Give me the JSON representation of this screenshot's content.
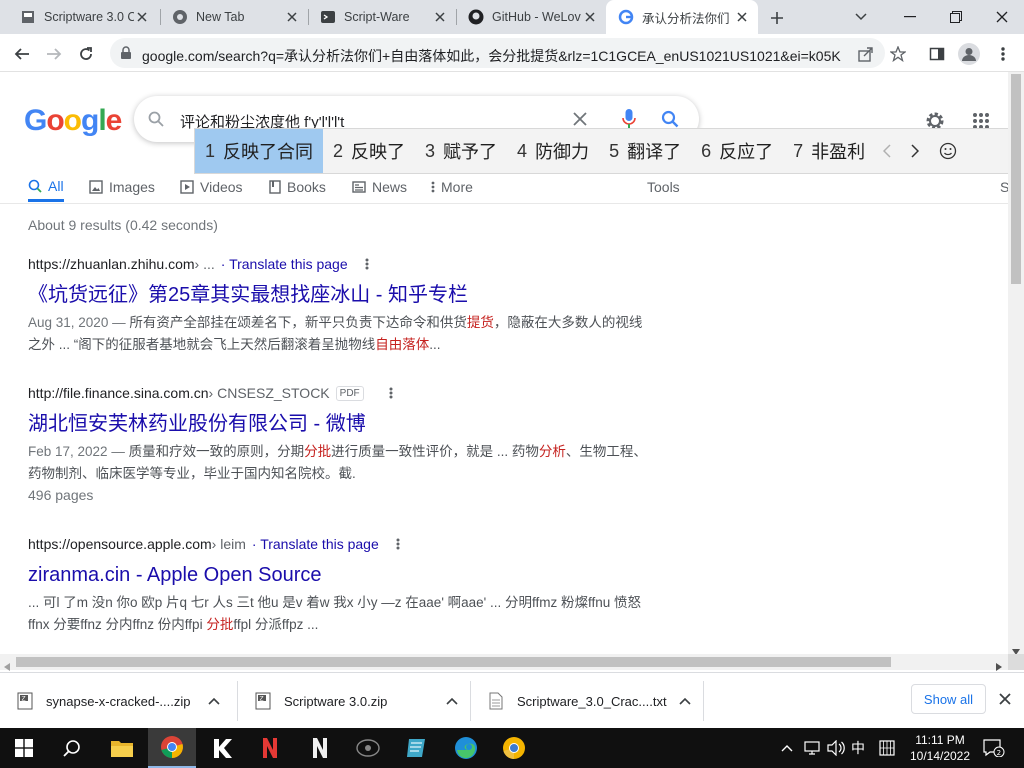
{
  "browser": {
    "tabs": [
      {
        "title": "Scriptware 3.0 C",
        "icon": "page-icon"
      },
      {
        "title": "New Tab",
        "icon": "chrome-icon"
      },
      {
        "title": "Script-Ware",
        "icon": "script-ware-icon"
      },
      {
        "title": "GitHub - WeLov",
        "icon": "github-icon"
      },
      {
        "title": "承认分析法你们",
        "icon": "google-icon",
        "active": true
      }
    ],
    "url": "google.com/search?q=承认分析法你们+自由落体如此，会分批提货&rlz=1C1GCEA_enUS1021US1021&ei=k05K..."
  },
  "google": {
    "logo": "Google",
    "query": "评论和粉尘浓度他 f'y'l'l'l't",
    "search_tabs": [
      "All",
      "Images",
      "Videos",
      "Books",
      "News",
      "More",
      "Tools",
      "S"
    ],
    "stats": "About 9 results (0.42 seconds)"
  },
  "ime": {
    "candidates": [
      {
        "n": "1",
        "text": "反映了合同"
      },
      {
        "n": "2",
        "text": "反映了"
      },
      {
        "n": "3",
        "text": "赋予了"
      },
      {
        "n": "4",
        "text": "防御力"
      },
      {
        "n": "5",
        "text": "翻译了"
      },
      {
        "n": "6",
        "text": "反应了"
      },
      {
        "n": "7",
        "text": "非盈利"
      }
    ]
  },
  "results": [
    {
      "domain": "https://zhuanlan.zhihu.com",
      "path": " › ...",
      "translate": "· Translate this page",
      "title": "《坑货远征》第25章其实最想找座冰山 - 知乎专栏",
      "date": "Aug 31, 2020 — ",
      "snippet_a": "所有资产全部挂在颂差名下，新平只负责下达命令和供货",
      "hl_a": "提货",
      "snippet_b": "，隐蔽在大多数人的视线之外 ... “阁下的征服者基地就会飞上天然后翻滚着呈抛物线",
      "hl_b": "自由落体",
      "snippet_c": "..."
    },
    {
      "domain": "http://file.finance.sina.com.cn",
      "path": " › CNSESZ_STOCK",
      "badge": "PDF",
      "title": "湖北恒安芙林药业股份有限公司 - 微博",
      "date": "Feb 17, 2022 — ",
      "snippet_a": "质量和疗效一致的原则，分期",
      "hl_a": "分批",
      "snippet_b": "进行质量一致性评价，就是 ... 药物",
      "hl_b": "分析",
      "snippet_c": "、生物工程、药物制剂、临床医学等专业，毕业于国内知名院校。截.",
      "extra": "496 pages"
    },
    {
      "domain": "https://opensource.apple.com",
      "path": " › leim",
      "translate": "· Translate this page",
      "title": "ziranma.cin - Apple Open Source",
      "snippet_a": "... 可l 了m 没n 你o 欧p 片q 七r 人s 三t 他u 是v 着w 我x 小y —z 在aae' 啊aae' ... 分明ffmz 粉燦ffnu 愤怒ffnx 分要ffnz 分内ffnz 份内ffpi ",
      "hl_a": "分批",
      "snippet_b": "ffpl 分派ffpz ..."
    }
  ],
  "downloads": [
    {
      "name": "synapse-x-cracked-....zip"
    },
    {
      "name": "Scriptware 3.0.zip"
    },
    {
      "name": "Scriptware_3.0_Crac....txt"
    }
  ],
  "show_all": "Show all",
  "taskbar": {
    "ime_mode": "中",
    "time": "11:11 PM",
    "date": "10/14/2022",
    "notification_count": "2"
  }
}
